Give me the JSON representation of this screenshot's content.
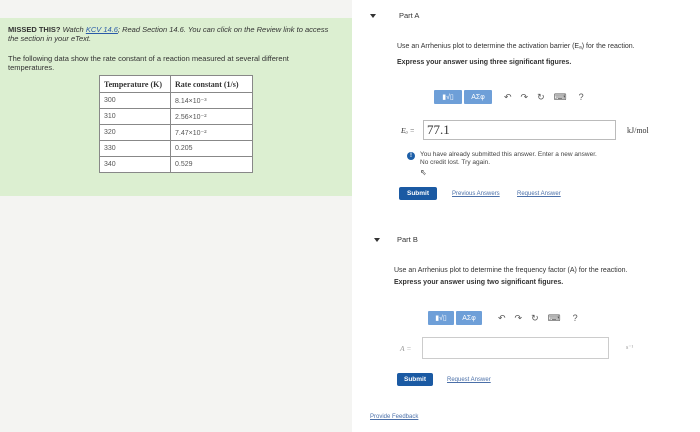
{
  "missed": {
    "bold": "MISSED THIS?",
    "watch_pre": " Watch ",
    "watch_link": "KCV 14.6",
    "watch_post": "; Read Section 14.6. You can click on the Review link to access the section in your eText.",
    "intro": "The following data show the rate constant of a reaction measured at several different temperatures.",
    "table": {
      "headers": [
        "Temperature (K)",
        "Rate constant (1/s)"
      ],
      "rows": [
        [
          "300",
          "8.14×10⁻³"
        ],
        [
          "310",
          "2.56×10⁻²"
        ],
        [
          "320",
          "7.47×10⁻²"
        ],
        [
          "330",
          "0.205"
        ],
        [
          "340",
          "0.529"
        ]
      ]
    }
  },
  "partA": {
    "label": "Part A",
    "question": "Use an Arrhenius plot to determine the activation barrier (Eₐ) for the reaction.",
    "instruction": "Express your answer using three significant figures.",
    "toolbar": {
      "btn1": "▮√▯",
      "btn2": "ΑΣφ",
      "help": "?"
    },
    "var_label": "Eₐ =",
    "answer_value": "77.1",
    "unit": "kJ/mol",
    "warning_line1": "You have already submitted this answer. Enter a new answer.",
    "warning_line2": "No credit lost. Try again.",
    "submit": "Submit",
    "link_prev": "Previous Answers",
    "link_req": "Request Answer"
  },
  "partB": {
    "label": "Part B",
    "question": "Use an Arrhenius plot to determine the frequency factor (A) for the reaction.",
    "instruction": "Express your answer using two significant figures.",
    "toolbar": {
      "btn1": "▮√▯",
      "btn2": "ΑΣφ",
      "help": "?"
    },
    "var_label": "A =",
    "answer_value": "",
    "unit": "s⁻¹",
    "submit": "Submit",
    "link_req": "Request Answer"
  },
  "footer": {
    "feedback": "Provide Feedback"
  },
  "colors": {
    "missed_bg": "#dcefd1",
    "toolbar_btn": "#6e9fd8",
    "submit": "#1b5aa3",
    "info_icon": "#1d5fa8"
  }
}
